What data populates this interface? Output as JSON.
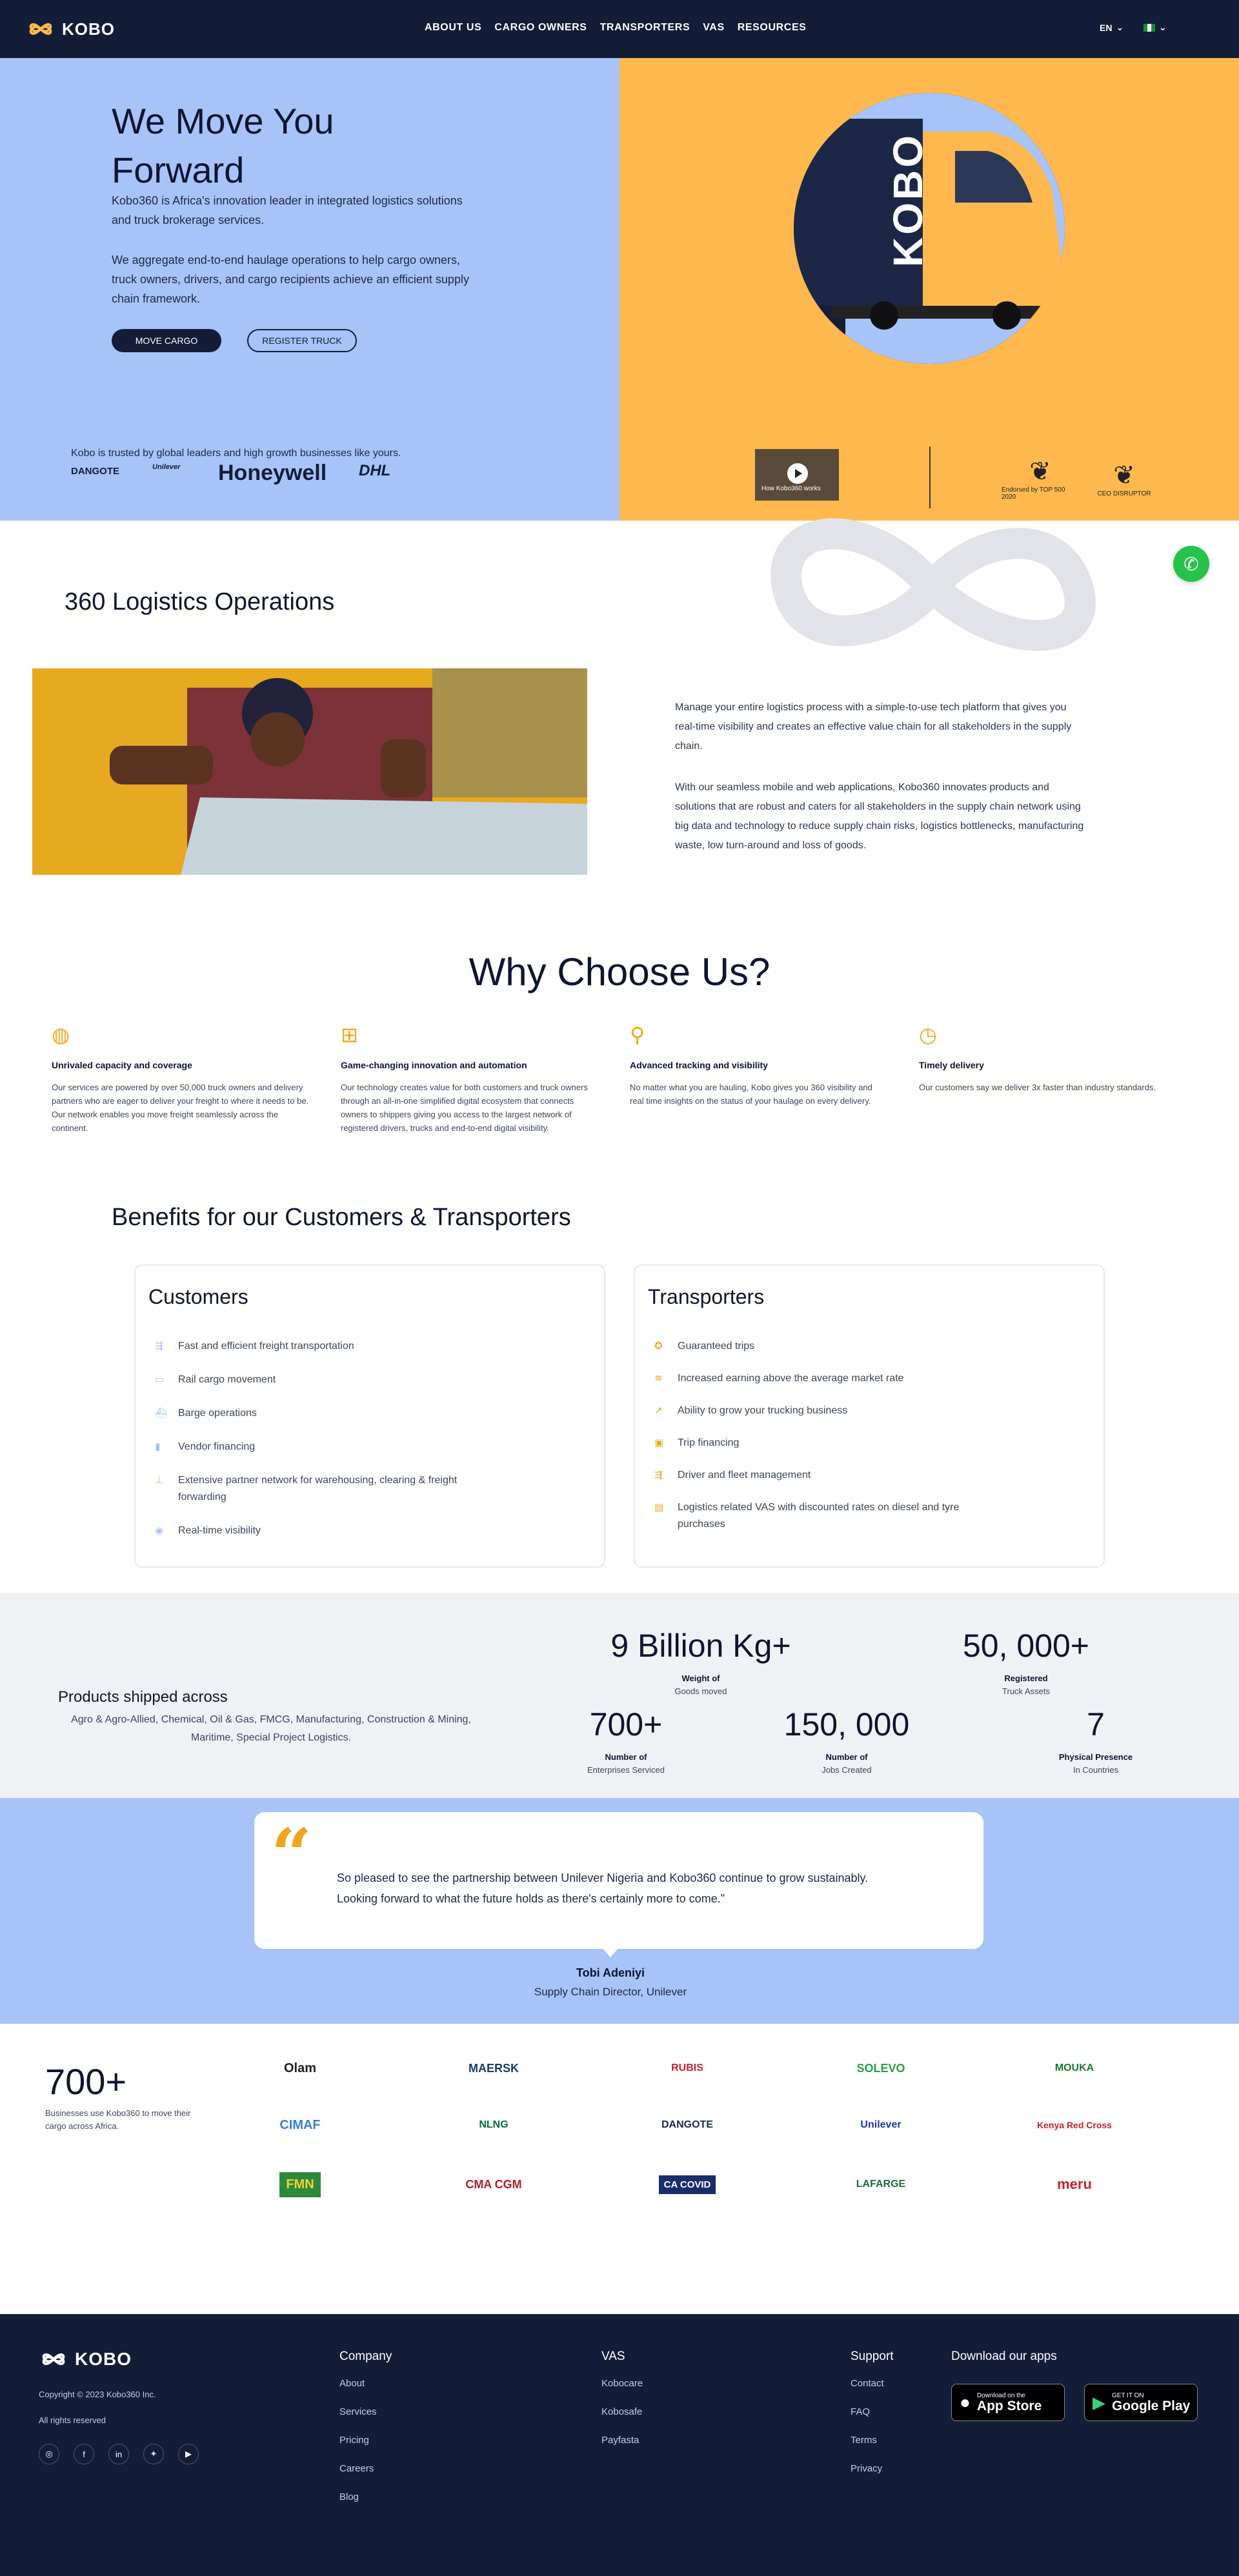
{
  "nav": {
    "brand": "KOBO",
    "links": [
      "ABOUT US",
      "CARGO OWNERS",
      "TRANSPORTERS",
      "VAS",
      "RESOURCES"
    ],
    "lang": "EN"
  },
  "hero": {
    "title": "We Move You Forward",
    "p1": "Kobo360 is Africa's innovation leader in integrated logistics solutions and truck brokerage services.",
    "p2": "We aggregate end-to-end haulage operations to help cargo owners, truck owners, drivers, and cargo recipients achieve an efficient supply chain framework.",
    "btn_move": "MOVE CARGO",
    "btn_register": "REGISTER TRUCK",
    "trusted": "Kobo is trusted by global leaders and high growth businesses like yours.",
    "trusted_logos": [
      "DANGOTE",
      "Unilever",
      "Honeywell",
      "DHL"
    ],
    "truck_brand": "KOBO",
    "video_caption": "How Kobo360 works",
    "awards": [
      "Endorsed by TOP 500 2020",
      "CEO DISRUPTOR"
    ]
  },
  "ops": {
    "title": "360 Logistics Operations",
    "p1": "Manage your entire logistics process with a simple-to-use tech platform that gives you real-time visibility and creates an effective value chain for all stakeholders in the supply chain.",
    "p2": "With our seamless mobile and web applications, Kobo360 innovates products and solutions that are robust and caters for all stakeholders in the supply chain network using big data and technology to reduce supply chain risks, logistics bottlenecks, manufacturing waste, low turn-around and loss of goods."
  },
  "why": {
    "title": "Why Choose Us?",
    "cards": [
      {
        "icon": "globe-icon",
        "title": "Unrivaled capacity and coverage",
        "text": "Our services are powered by over 50,000 truck owners and delivery partners who are eager to deliver your freight to where it needs to be. Our network enables you move freight seamlessly across the continent."
      },
      {
        "icon": "chip-icon",
        "title": "Game-changing innovation and automation",
        "text": "Our technology creates value for both customers and truck owners through an all-in-one simplified digital ecosystem that connects owners to shippers giving you access to the largest network of registered drivers, trucks and end-to-end digital visibility."
      },
      {
        "icon": "location-pin-icon",
        "title": "Advanced tracking and visibility",
        "text": "No matter what you are hauling, Kobo gives you 360 visibility and real time insights on the status of your haulage on every delivery."
      },
      {
        "icon": "clock-icon",
        "title": "Timely delivery",
        "text": "Our customers say we deliver 3x faster than industry standards."
      }
    ]
  },
  "benefits": {
    "title": "Benefits for our Customers & Transporters",
    "customers": {
      "title": "Customers",
      "items": [
        "Fast and efficient freight transportation",
        "Rail cargo movement",
        "Barge operations",
        "Vendor financing",
        "Extensive partner network for warehousing, clearing & freight forwarding",
        "Real-time visibility"
      ]
    },
    "transporters": {
      "title": "Transporters",
      "items": [
        "Guaranteed trips",
        "Increased earning above the average market rate",
        "Ability to grow your trucking business",
        "Trip financing",
        "Driver and fleet management",
        "Logistics related VAS with discounted rates on diesel and tyre purchases"
      ]
    }
  },
  "stats": {
    "products_title": "Products shipped across",
    "products_text": "Agro & Agro-Allied, Chemical, Oil & Gas, FMCG, Manufacturing, Construction & Mining, Maritime, Special Project Logistics.",
    "items": [
      {
        "num": "9 Billion Kg+",
        "l1": "Weight of",
        "l2": "Goods moved"
      },
      {
        "num": "50, 000+",
        "l1": "Registered",
        "l2": "Truck Assets"
      },
      {
        "num": "700+",
        "l1": "Number of",
        "l2": "Enterprises Serviced"
      },
      {
        "num": "150, 000",
        "l1": "Number of",
        "l2": "Jobs Created"
      },
      {
        "num": "7",
        "l1": "Physical Presence",
        "l2": "In Countries"
      }
    ]
  },
  "testimonial": {
    "quote": "So pleased to see the partnership between Unilever Nigeria and Kobo360 continue to grow sustainably. Looking forward to what the future holds as there's certainly more to come.\"",
    "name": "Tobi Adeniyi",
    "role": "Supply Chain Director, Unilever"
  },
  "partners": {
    "count": "700+",
    "text": "Businesses use Kobo360 to move their cargo across Africa.",
    "logos": [
      "Olam",
      "MAERSK",
      "RUBIS",
      "SOLEVO",
      "MOUKA",
      "CIMAF",
      "NLNG",
      "DANGOTE",
      "Unilever",
      "Kenya Red Cross",
      "FMN",
      "CMA CGM",
      "CA COVID",
      "LAFARGE",
      "meru"
    ]
  },
  "footer": {
    "brand": "KOBO",
    "copyright": "Copyright © 2023 Kobo360 Inc.",
    "rights": "All rights reserved",
    "social": [
      "instagram-icon",
      "facebook-icon",
      "linkedin-icon",
      "twitter-icon",
      "youtube-icon"
    ],
    "company_title": "Company",
    "company": [
      "About",
      "Services",
      "Pricing",
      "Careers",
      "Blog"
    ],
    "vas_title": "VAS",
    "vas": [
      "Kobocare",
      "Kobosafe",
      "Payfasta"
    ],
    "support_title": "Support",
    "support": [
      "Contact",
      "FAQ",
      "Terms",
      "Privacy"
    ],
    "apps_title": "Download our apps",
    "appstore_small": "Download on the",
    "appstore_big": "App Store",
    "gplay_small": "GET IT ON",
    "gplay_big": "Google Play"
  },
  "colors": {
    "navy": "#131d38",
    "blue": "#a7c3f7",
    "orange": "#ffb84d",
    "accent": "#f0a51c",
    "whatsapp": "#28c24a"
  }
}
